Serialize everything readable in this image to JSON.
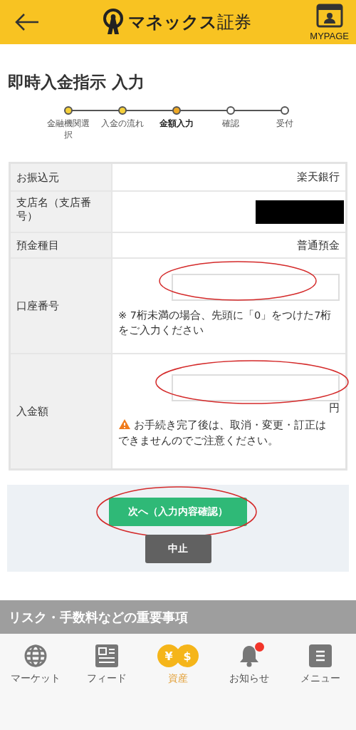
{
  "header": {
    "brand": "マネックス",
    "brand_suffix": "証券",
    "mypage": "MYPAGE"
  },
  "title": "即時入金指示 入力",
  "steps": [
    {
      "label": "金融機関選択",
      "done": true,
      "selected": false
    },
    {
      "label": "入金の流れ",
      "done": true,
      "selected": false
    },
    {
      "label": "金額入力",
      "done": false,
      "selected": true
    },
    {
      "label": "確認",
      "done": false,
      "selected": false
    },
    {
      "label": "受付",
      "done": false,
      "selected": false
    }
  ],
  "form": {
    "rows": [
      {
        "kind": "text",
        "label": "お振込元",
        "value": "楽天銀行"
      },
      {
        "kind": "redacted",
        "label": "支店名（支店番号）"
      },
      {
        "kind": "text",
        "label": "預金種目",
        "value": "普通預金"
      },
      {
        "kind": "input",
        "label": "口座番号",
        "highlighted": true,
        "note": "※ 7桁未満の場合、先頭に「0」をつけた7桁をご入力ください"
      },
      {
        "kind": "amount",
        "label": "入金額",
        "highlighted": true,
        "unit": "円",
        "warning": "お手続き完了後は、取消・変更・訂正はできませんのでご注意ください。"
      }
    ]
  },
  "buttons": [
    {
      "kind": "primary",
      "label": "次へ（入力内容確認）",
      "highlighted": true
    },
    {
      "kind": "secondary",
      "label": "中止",
      "highlighted": false
    }
  ],
  "risk_banner": "リスク・手数料などの重要事項",
  "nav": [
    {
      "kind": "globe",
      "label": "マーケット",
      "selected": false,
      "badge": false
    },
    {
      "kind": "feed",
      "label": "フィード",
      "selected": false,
      "badge": false
    },
    {
      "kind": "coins",
      "label": "資産",
      "selected": true,
      "badge": false,
      "glyphs": [
        "¥",
        "$"
      ]
    },
    {
      "kind": "bell",
      "label": "お知らせ",
      "selected": false,
      "badge": true
    },
    {
      "kind": "menu",
      "label": "メニュー",
      "selected": false,
      "badge": false
    }
  ]
}
